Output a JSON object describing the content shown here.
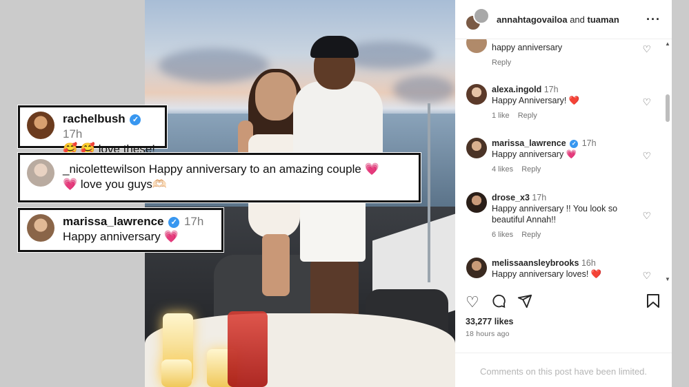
{
  "post": {
    "header": {
      "user1": "annahtagovailoa",
      "conjunction": "and",
      "user2": "tuaman"
    },
    "comments": [
      {
        "username": "",
        "time": "",
        "text": "happy anniversary",
        "likes": "",
        "reply": "Reply"
      },
      {
        "username": "alexa.ingold",
        "time": "17h",
        "text": "Happy Anniversary! ❤️",
        "likes": "1 like",
        "reply": "Reply"
      },
      {
        "username": "marissa_lawrence",
        "time": "17h",
        "text": "Happy anniversary 💗",
        "likes": "4 likes",
        "reply": "Reply"
      },
      {
        "username": "drose_x3",
        "time": "17h",
        "text": "Happy anniversary !! You look so beautiful Annah!!",
        "likes": "6 likes",
        "reply": "Reply"
      },
      {
        "username": "melissaansleybrooks",
        "time": "16h",
        "text": "Happy anniversary loves! ❤️",
        "likes": "",
        "reply": ""
      }
    ],
    "like_count": "33,277 likes",
    "posted_ago": "18 hours ago",
    "limited_notice": "Comments on this post have been limited."
  },
  "callouts": [
    {
      "username": "rachelbush",
      "time": "17h",
      "text": "🥰 🥰 love these!"
    },
    {
      "username": "_nicolettewilson",
      "time": "",
      "text": "Happy anniversary to an amazing couple 💗",
      "text2": "💗 love you guys🫶🏻"
    },
    {
      "username": "marissa_lawrence",
      "time": "17h",
      "text": "Happy anniversary 💗"
    }
  ],
  "icons": {
    "verified": "verified-badge-icon",
    "like": "heart-icon",
    "comment": "comment-icon",
    "share": "share-icon",
    "save": "bookmark-icon",
    "more": "more-icon"
  },
  "colors": {
    "verified": "#3897f0",
    "heart": "#ed4956",
    "pink_heart": "#e8418a"
  }
}
